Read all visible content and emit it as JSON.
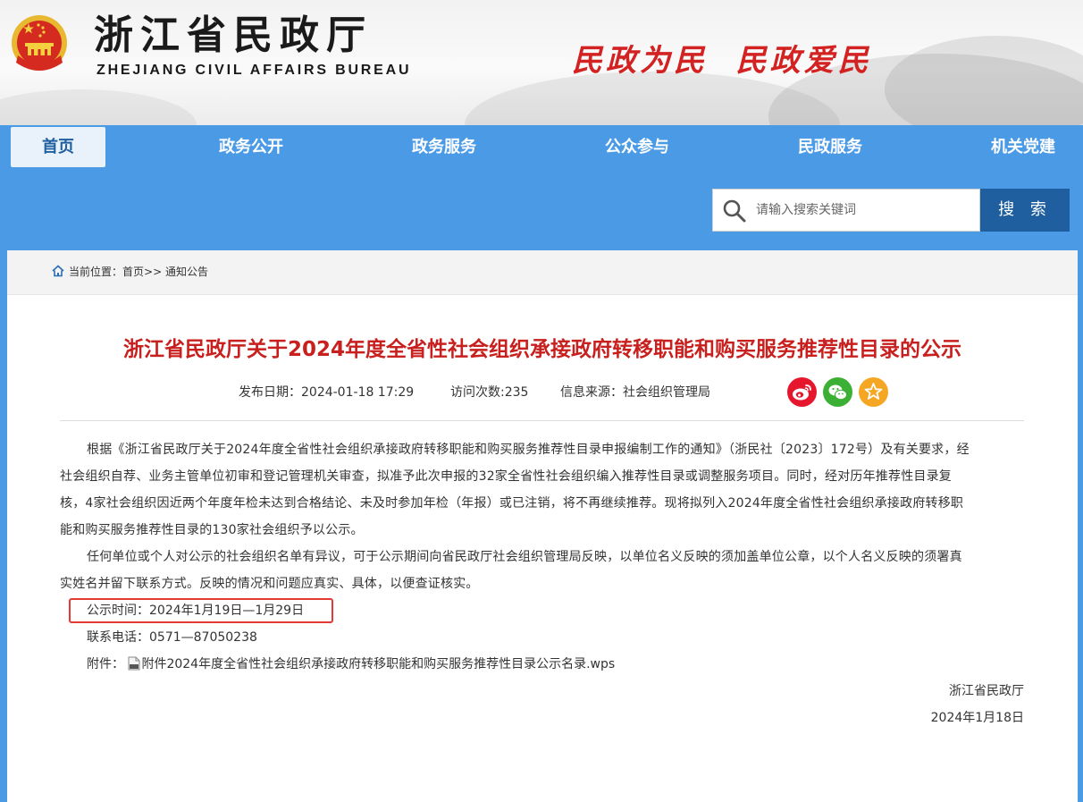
{
  "header": {
    "site_name": "浙江省民政厅",
    "site_name_en": "ZHEJIANG CIVIL AFFAIRS BUREAU",
    "slogan": "民政为民  民政爱民",
    "emblem_icon": "national-emblem-icon"
  },
  "nav": {
    "items": [
      {
        "label": "首页",
        "active": true
      },
      {
        "label": "政务公开",
        "active": false
      },
      {
        "label": "政务服务",
        "active": false
      },
      {
        "label": "公众参与",
        "active": false
      },
      {
        "label": "民政服务",
        "active": false
      },
      {
        "label": "机关党建",
        "active": false
      }
    ]
  },
  "search": {
    "placeholder": "请输入搜索关键词",
    "value": "",
    "button_label": "搜 索",
    "icon": "search-icon"
  },
  "breadcrumb": {
    "prefix": "当前位置：",
    "home": "首页",
    "sep": ">>",
    "current": "通知公告",
    "icon": "home-icon"
  },
  "article": {
    "title": "浙江省民政厅关于2024年度全省性社会组织承接政府转移职能和购买服务推荐性目录的公示",
    "publish_date": "发布日期：2024-01-18 17:29",
    "visits": "访问次数:235",
    "source": "信息来源：社会组织管理局",
    "share_icons": [
      "weibo-icon",
      "wechat-icon",
      "favorite-star-icon"
    ],
    "paragraph1_lines": [
      "根据《浙江省民政厅关于2024年度全省性社会组织承接政府转移职能和购买服务推荐性目录申报编制工作的通知》（浙民社〔2023〕172号）及有关要求，经",
      "社会组织自荐、业务主管单位初审和登记管理机关审查，拟准予此次申报的32家全省性社会组织编入推荐性目录或调整服务项目。同时，经对历年推荐性目录复",
      "核，4家社会组织因近两个年度年检未达到合格结论、未及时参加年检（年报）或已注销，将不再继续推荐。现将拟列入2024年度全省性社会组织承接政府转移职",
      "能和购买服务推荐性目录的130家社会组织予以公示。"
    ],
    "paragraph2_lines": [
      "任何单位或个人对公示的社会组织名单有异议，可于公示期间向省民政厅社会组织管理局反映，以单位名义反映的须加盖单位公章，以个人名义反映的须署真",
      "实姓名并留下联系方式。反映的情况和问题应真实、具体，以便查证核实。"
    ],
    "period": "公示时间：2024年1月19日—1月29日",
    "phone": "联系电话：0571—87050238",
    "attachment_label": "附件：",
    "attachment_name": "附件2024年度全省性社会组织承接政府转移职能和购买服务推荐性目录公示名录.wps",
    "attachment_icon": "wps-file-icon",
    "sign_org": "浙江省民政厅",
    "sign_date": "2024年1月18日"
  },
  "colors": {
    "nav_bg": "#4a9ae6",
    "search_button": "#1f5f9f",
    "title_red": "#c8201e",
    "highlight_red": "#e53935",
    "weibo": "#e6162d",
    "wechat": "#3cb034",
    "favorite": "#f5a623"
  }
}
